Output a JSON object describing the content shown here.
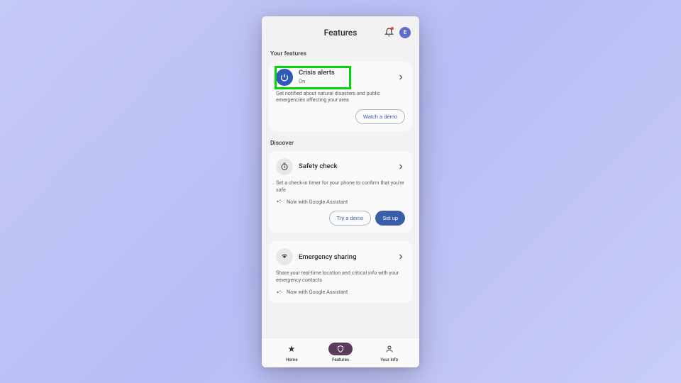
{
  "header": {
    "title": "Features",
    "avatar_initial": "E"
  },
  "your_features": {
    "label": "Your features",
    "crisis": {
      "title": "Crisis alerts",
      "status": "On",
      "desc": "Get notified about natural disasters and public emergencies affecting your area",
      "demo_btn": "Watch a demo"
    }
  },
  "discover": {
    "label": "Discover",
    "safety": {
      "title": "Safety check",
      "desc": "Set a check-in timer for your phone to confirm that you're safe",
      "assistant": "Now with Google Assistant",
      "demo_btn": "Try a demo",
      "setup_btn": "Set up"
    },
    "emergency": {
      "title": "Emergency sharing",
      "desc": "Share your real-time location and critical info with your emergency contacts",
      "assistant": "Now with Google Assistant"
    }
  },
  "nav": {
    "home": "Home",
    "features": "Features",
    "your_info": "Your info"
  }
}
